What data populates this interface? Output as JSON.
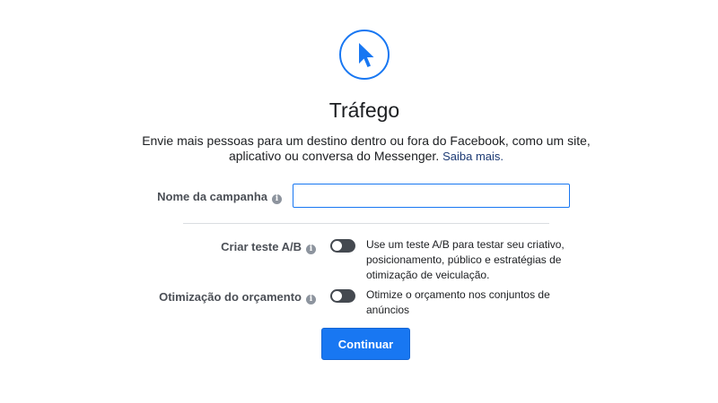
{
  "objective": {
    "icon": "cursor-arrow-icon",
    "title": "Tráfego",
    "description": "Envie mais pessoas para um destino dentro ou fora do Facebook, como um site, aplicativo ou conversa do Messenger.",
    "learn_more": "Saiba mais."
  },
  "campaign_name": {
    "label": "Nome da campanha",
    "value": "",
    "placeholder": "",
    "info_icon": "info-icon"
  },
  "ab_test": {
    "label": "Criar teste A/B",
    "enabled": false,
    "description": "Use um teste A/B para testar seu criativo, posicionamento, público e estratégias de otimização de veiculação."
  },
  "budget_optimization": {
    "label": "Otimização do orçamento",
    "enabled": false,
    "description": "Otimize o orçamento nos conjuntos de anúncios"
  },
  "actions": {
    "continue_label": "Continuar"
  },
  "colors": {
    "accent": "#1877f2",
    "toggle_off": "#444950",
    "link": "#1c3a74"
  }
}
